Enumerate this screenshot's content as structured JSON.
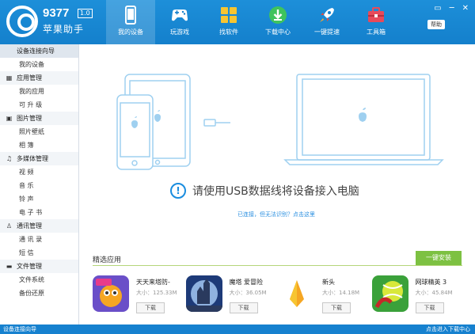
{
  "header": {
    "logo_number": "9377",
    "logo_version": "1.0",
    "logo_name": "苹果助手",
    "nav": [
      {
        "label": "我的设备",
        "icon": "phone-icon",
        "active": true
      },
      {
        "label": "玩游戏",
        "icon": "gamepad-icon",
        "active": false
      },
      {
        "label": "找软件",
        "icon": "apps-grid-icon",
        "active": false
      },
      {
        "label": "下载中心",
        "icon": "download-icon",
        "active": false
      },
      {
        "label": "一键提速",
        "icon": "rocket-icon",
        "active": false
      },
      {
        "label": "工具箱",
        "icon": "toolbox-icon",
        "active": false
      }
    ],
    "help_label": "帮助",
    "window_controls": [
      "▭",
      "─",
      "✕"
    ]
  },
  "sidebar": {
    "groups": [
      {
        "label": "设备连接向导",
        "icon": "apple-icon",
        "items": [
          "我的设备"
        ]
      },
      {
        "label": "应用管理",
        "icon": "app-manage-icon",
        "items": [
          "我的应用",
          "可 升 级"
        ]
      },
      {
        "label": "图片管理",
        "icon": "image-icon",
        "items": [
          "照片壁纸",
          "相      簿"
        ]
      },
      {
        "label": "多媒体管理",
        "icon": "music-icon",
        "items": [
          "视      频",
          "音      乐",
          "铃      声",
          "电 子 书"
        ]
      },
      {
        "label": "通讯管理",
        "icon": "contact-icon",
        "items": [
          "通 讯 录",
          "短      信"
        ]
      },
      {
        "label": "文件管理",
        "icon": "folder-icon",
        "items": [
          "文件系统",
          "备份还原"
        ]
      }
    ]
  },
  "main": {
    "message": "请使用USB数据线将设备接入电脑",
    "sub_link": "已连接，但无法识别？点击这里",
    "section_title": "精选应用",
    "install_button": "一键安装",
    "apps": [
      {
        "name": "天天来塔防-",
        "size": "大小：125.33M",
        "download": "下载",
        "icon": "tower-defense-app-icon"
      },
      {
        "name": "魔塔 爱冒险",
        "size": "大小：36.05M",
        "download": "下载",
        "icon": "magic-tower-app-icon"
      },
      {
        "name": "新头",
        "size": "大小：14.18M",
        "download": "下载",
        "icon": "news-app-icon"
      },
      {
        "name": "网球精英 3",
        "size": "大小：45.84M",
        "download": "下载",
        "icon": "tennis-app-icon"
      }
    ]
  },
  "status": {
    "left": "设备连接向导",
    "right": "点击进入下载中心"
  },
  "colors": {
    "header_blue": "#1480cc",
    "accent_blue": "#1a8ddf",
    "install_green": "#7dc142"
  }
}
